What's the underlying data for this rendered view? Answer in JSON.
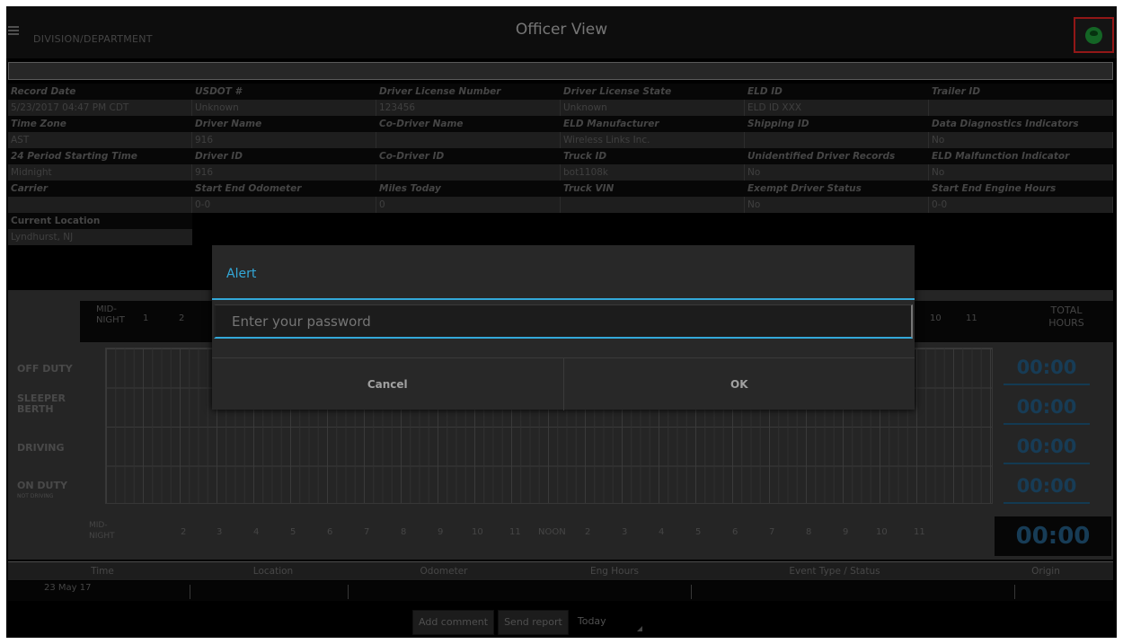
{
  "header": {
    "department": "DIVISION/DEPARTMENT",
    "title": "Officer View"
  },
  "info": {
    "rows": [
      {
        "labels": [
          "Record Date",
          "USDOT #",
          "Driver License Number",
          "Driver License State",
          "ELD ID",
          "Trailer ID"
        ],
        "values": [
          "5/23/2017 04:47 PM CDT",
          "Unknown",
          "123456",
          "Unknown",
          "ELD ID XXX",
          ""
        ]
      },
      {
        "labels": [
          "Time Zone",
          "Driver Name",
          "Co-Driver Name",
          "ELD Manufacturer",
          "Shipping ID",
          "Data Diagnostics Indicators"
        ],
        "values": [
          "AST",
          "916",
          "",
          "Wireless Links Inc.",
          "",
          "No"
        ]
      },
      {
        "labels": [
          "24 Period Starting Time",
          "Driver ID",
          "Co-Driver ID",
          "Truck ID",
          "Unidentified Driver Records",
          "ELD Malfunction Indicator"
        ],
        "values": [
          "Midnight",
          "916",
          "",
          "bot1108k",
          "No",
          "No"
        ]
      },
      {
        "labels": [
          "Carrier",
          "Start End Odometer",
          "Miles Today",
          "Truck VIN",
          "Exempt Driver Status",
          "Start End Engine Hours"
        ],
        "values": [
          "",
          "0-0",
          "0",
          "",
          "No",
          "0-0"
        ]
      }
    ],
    "location_label": "Current Location",
    "location_value": "Lyndhurst, NJ"
  },
  "log": {
    "mid_label": "MID-NIGHT",
    "total_label": "TOTAL HOURS",
    "hour_labels_top": [
      "1",
      "2",
      "10",
      "11"
    ],
    "hour_labels_bottom": [
      "2",
      "3",
      "4",
      "5",
      "6",
      "7",
      "8",
      "9",
      "10",
      "11",
      "NOON",
      "2",
      "3",
      "4",
      "5",
      "6",
      "7",
      "8",
      "9",
      "10",
      "11"
    ],
    "rows": [
      {
        "label": "OFF DUTY",
        "sub": "",
        "total": "00:00"
      },
      {
        "label": "SLEEPER BERTH",
        "sub": "",
        "total": "00:00"
      },
      {
        "label": "DRIVING",
        "sub": "",
        "total": "00:00"
      },
      {
        "label": "ON DUTY",
        "sub": "NOT DRIVING",
        "total": "00:00"
      }
    ],
    "grand_total": "00:00"
  },
  "events": {
    "columns": [
      "Time",
      "Location",
      "Odometer",
      "Eng Hours",
      "Event Type / Status",
      "Origin"
    ],
    "first_date": "23 May 17"
  },
  "footer": {
    "add_comment": "Add comment",
    "send_report": "Send report",
    "day_select": "Today"
  },
  "dialog": {
    "title": "Alert",
    "password_placeholder": "Enter your password",
    "cancel": "Cancel",
    "ok": "OK"
  },
  "colors": {
    "accent": "#33a8d8",
    "totals": "#245c84",
    "status_highlight": "#e02424",
    "status_icon": "#1f9c3a"
  }
}
